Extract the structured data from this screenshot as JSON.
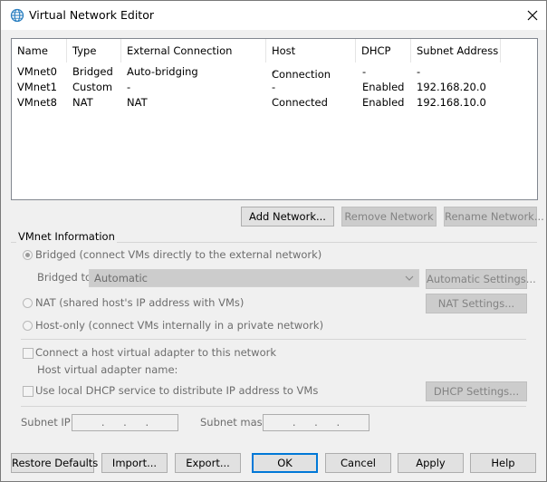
{
  "window": {
    "title": "Virtual Network Editor"
  },
  "table": {
    "columns": [
      "Name",
      "Type",
      "External Connection",
      "Host Connection",
      "DHCP",
      "Subnet Address"
    ],
    "rows": [
      [
        "VMnet0",
        "Bridged",
        "Auto-bridging",
        "-",
        "-",
        "-"
      ],
      [
        "VMnet1",
        "Custom",
        "-",
        "-",
        "Enabled",
        "192.168.20.0"
      ],
      [
        "VMnet8",
        "NAT",
        "NAT",
        "Connected",
        "Enabled",
        "192.168.10.0"
      ]
    ]
  },
  "network_buttons": {
    "add": "Add Network...",
    "remove": "Remove Network",
    "rename": "Rename Network..."
  },
  "vmnet_info": {
    "group_label": "VMnet Information",
    "bridged_label": "Bridged (connect VMs directly to the external network)",
    "bridged_to_label": "Bridged to:",
    "bridged_to_value": "Automatic",
    "auto_settings": "Automatic Settings...",
    "nat_label": "NAT (shared host's IP address with VMs)",
    "nat_settings": "NAT Settings...",
    "hostonly_label": "Host-only (connect VMs internally in a private network)",
    "connect_adapter_label": "Connect a host virtual adapter to this network",
    "adapter_name_label": "Host virtual adapter name:",
    "dhcp_label": "Use local DHCP service to distribute IP address to VMs",
    "dhcp_settings": "DHCP Settings...",
    "subnet_ip_label": "Subnet IP:",
    "subnet_ip_value": ". . .",
    "subnet_mask_label": "Subnet mask:",
    "subnet_mask_value": ". . ."
  },
  "footer": {
    "restore": "Restore Defaults",
    "import": "Import...",
    "export": "Export...",
    "ok": "OK",
    "cancel": "Cancel",
    "apply": "Apply",
    "help": "Help"
  }
}
